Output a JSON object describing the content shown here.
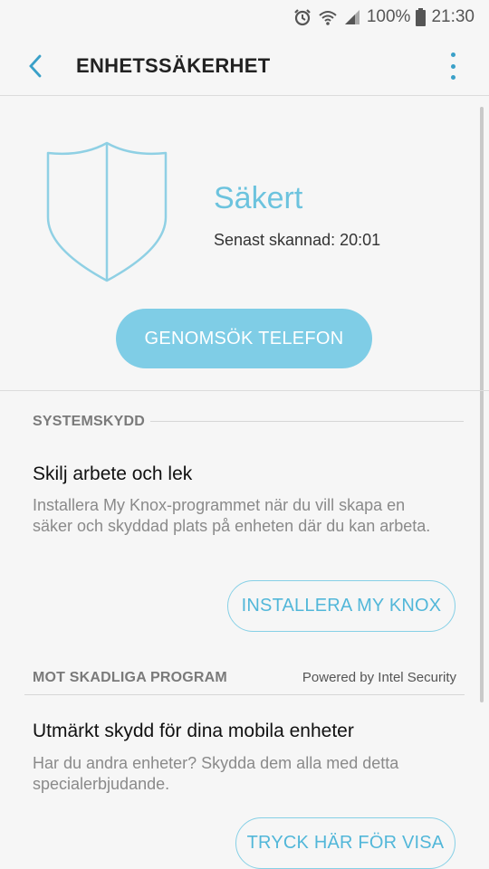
{
  "status_bar": {
    "battery": "100%",
    "time": "21:30"
  },
  "app_bar": {
    "title": "ENHETSSÄKERHET"
  },
  "device_status": {
    "title": "Säkert",
    "last_scan": "Senast skannad: 20:01",
    "scan_button": "GENOMSÖK TELEFON"
  },
  "sections": {
    "system_protection": {
      "header": "SYSTEMSKYDD",
      "item_title": "Skilj arbete och lek",
      "item_desc": "Installera My Knox-programmet när du vill skapa en säker och skyddad plats på enheten där du kan arbeta.",
      "button": "INSTALLERA MY KNOX"
    },
    "malware": {
      "header": "MOT SKADLIGA PROGRAM",
      "powered_by": "Powered by Intel Security",
      "item_title": "Utmärkt skydd för dina mobila enheter",
      "item_desc": "Har du andra enheter? Skydda dem alla med detta specialerbjudande.",
      "button": "TRYCK HÄR FÖR VISA"
    }
  },
  "colors": {
    "accent": "#6cc3de",
    "button_fill": "#7fcde6",
    "outline": "#86d0e6",
    "background": "#f6f6f6"
  }
}
